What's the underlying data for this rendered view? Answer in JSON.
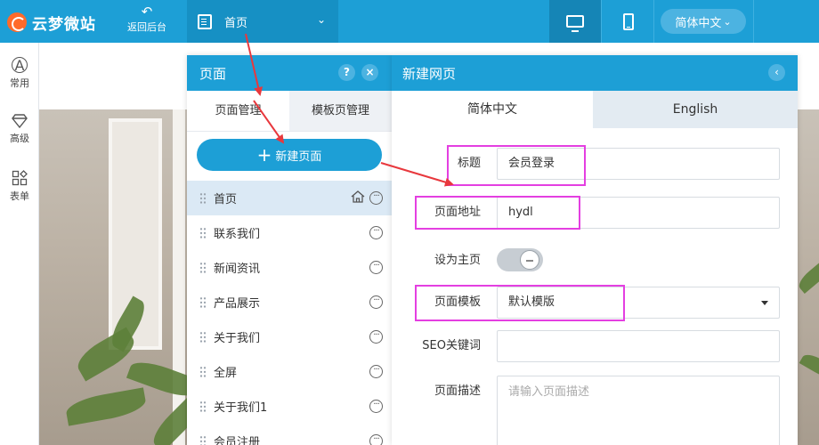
{
  "topbar": {
    "logo_text": "云梦微站",
    "back_label": "返回后台",
    "back_icon": "↶",
    "current_page": "首页",
    "chevron": "⌄",
    "language": "简体中文"
  },
  "left_toolbar": {
    "items": [
      {
        "label": "常用",
        "icon": "A"
      },
      {
        "label": "高级",
        "icon": "diamond-icon"
      },
      {
        "label": "表单",
        "icon": "form-grid-icon"
      }
    ]
  },
  "page_panel": {
    "title": "页面",
    "help_icon": "?",
    "close_icon": "×",
    "tabs": [
      "页面管理",
      "模板页管理"
    ],
    "new_page_label": "新建页面",
    "pages": [
      {
        "name": "首页",
        "selected": true,
        "is_home": true
      },
      {
        "name": "联系我们"
      },
      {
        "name": "新闻资讯"
      },
      {
        "name": "产品展示"
      },
      {
        "name": "关于我们"
      },
      {
        "name": "全屏"
      },
      {
        "name": "关于我们1"
      },
      {
        "name": "会员注册"
      }
    ]
  },
  "new_page_panel": {
    "title": "新建网页",
    "collapse_icon": "‹",
    "tabs": [
      "简体中文",
      "English"
    ],
    "fields": {
      "title_label": "标题",
      "title_value": "会员登录",
      "url_label": "页面地址",
      "url_value": "hydl",
      "home_label": "设为主页",
      "home_value": false,
      "template_label": "页面模板",
      "template_value": "默认模版",
      "seo_label": "SEO关键词",
      "seo_value": "",
      "desc_label": "页面描述",
      "desc_placeholder": "请输入页面描述"
    }
  },
  "colors": {
    "primary": "#1d9fd6",
    "highlight_box": "#e43fe1",
    "arrow": "#e8383d"
  }
}
